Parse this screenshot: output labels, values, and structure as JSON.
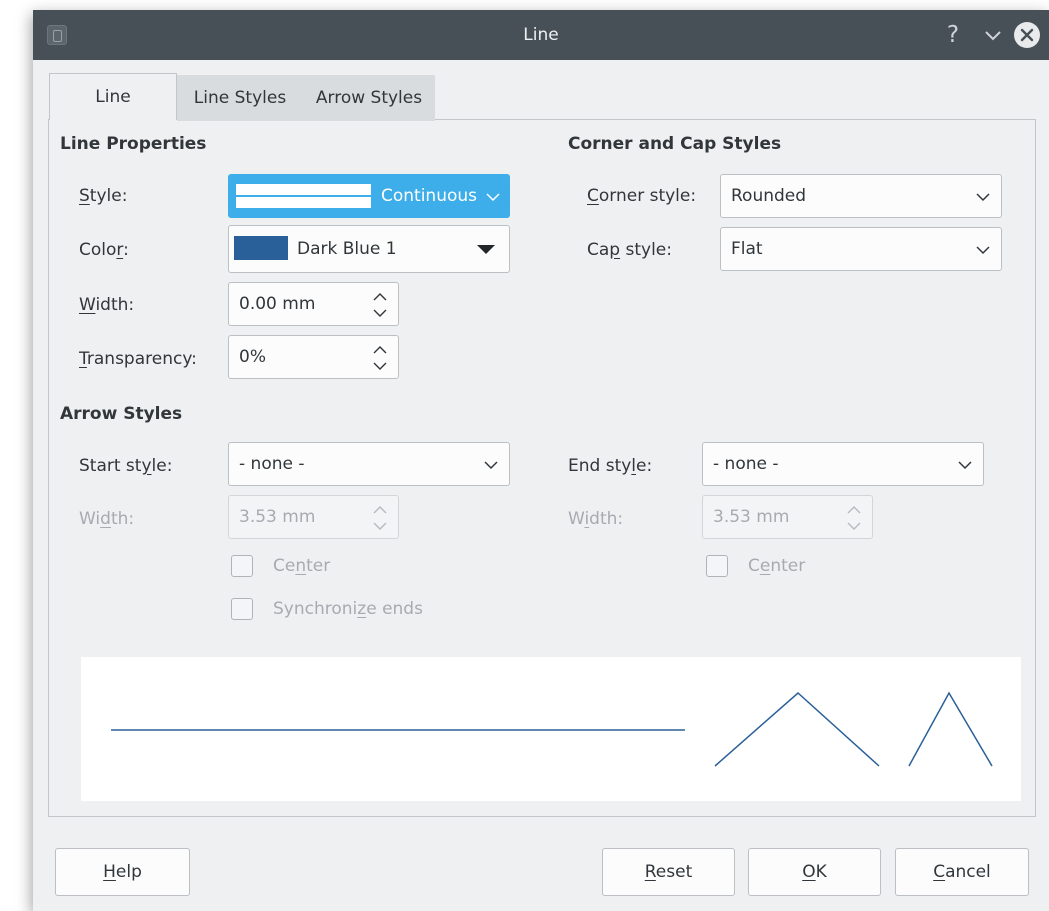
{
  "window": {
    "title": "Line"
  },
  "tabs": [
    {
      "label": "Line"
    },
    {
      "label": "Line Styles"
    },
    {
      "label": "Arrow Styles"
    }
  ],
  "line_properties": {
    "heading": "Line Properties",
    "style": {
      "label_a": "",
      "label_u": "S",
      "label_b": "tyle:",
      "value": "Continuous"
    },
    "color": {
      "label_a": "Colo",
      "label_u": "r",
      "label_b": ":",
      "value": "Dark Blue 1",
      "swatch": "#2a6099"
    },
    "width": {
      "label_a": "",
      "label_u": "W",
      "label_b": "idth:",
      "value": "0.00 mm"
    },
    "transparency": {
      "label_a": "",
      "label_u": "T",
      "label_b": "ransparency:",
      "value": "0%"
    }
  },
  "corner_cap": {
    "heading": "Corner and Cap Styles",
    "corner": {
      "label_a": "",
      "label_u": "C",
      "label_b": "orner style:",
      "value": "Rounded"
    },
    "cap": {
      "label_a": "Ca",
      "label_u": "p",
      "label_b": " style:",
      "value": "Flat"
    }
  },
  "arrow_styles": {
    "heading": "Arrow Styles",
    "start": {
      "label_a": "Start st",
      "label_u": "y",
      "label_b": "le:",
      "value": "- none -",
      "width_label_a": "Wi",
      "width_label_u": "d",
      "width_label_b": "th:",
      "width_value": "3.53 mm",
      "center_a": "Ce",
      "center_u": "n",
      "center_b": "ter"
    },
    "end": {
      "label_a": "End sty",
      "label_u": "l",
      "label_b": "e:",
      "value": "- none -",
      "width_label_a": "W",
      "width_label_u": "i",
      "width_label_b": "dth:",
      "width_value": "3.53 mm",
      "center_a": "C",
      "center_u": "e",
      "center_b": "nter"
    },
    "sync_a": "Synchroni",
    "sync_u": "z",
    "sync_b": "e ends"
  },
  "buttons": {
    "help": {
      "u": "H",
      "b": "elp"
    },
    "reset": {
      "u": "R",
      "b": "eset"
    },
    "ok": {
      "u": "O",
      "b": "K"
    },
    "cancel": {
      "u": "C",
      "b": "ancel"
    }
  },
  "colors": {
    "accent": "#3daee9",
    "line": "#2a6099",
    "titlebar": "#475057"
  }
}
